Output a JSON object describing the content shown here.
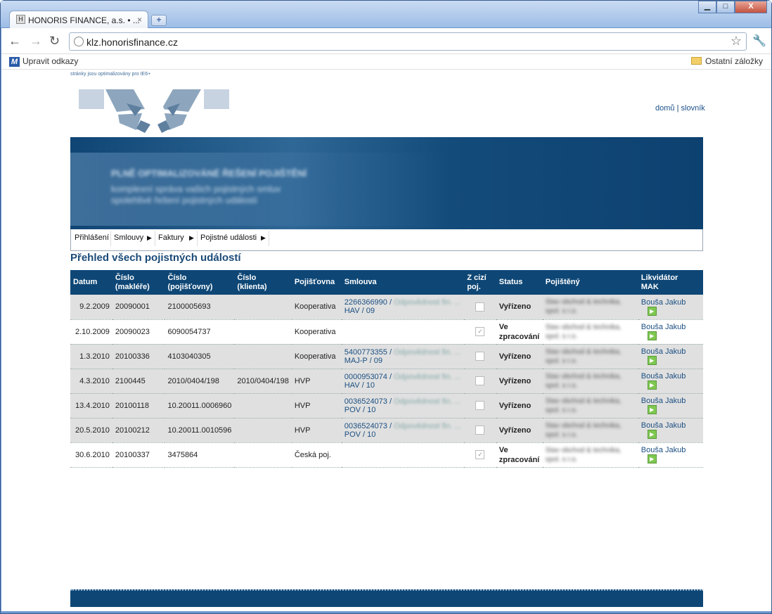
{
  "browser": {
    "tab_title": "HONORIS FINANCE, a.s. • ...",
    "tab_close": "×",
    "new_tab": "+",
    "url": "klz.honorisfinance.cz",
    "bookmark_left": "Upravit odkazy",
    "bookmark_right": "Ostatní záložky",
    "min": "▁",
    "max": "□",
    "close": "X"
  },
  "page": {
    "optimized_note": "stránky jsou optimalizovány pro IE6+",
    "top_links": {
      "home": "domů",
      "sep": " | ",
      "dictionary": "slovník"
    },
    "banner_lines": [
      "PLNĚ OPTIMALIZOVÁNÉ ŘEŠENÍ POJIŠTĚNÍ",
      "komplexní správa vašich pojistných smluv",
      "spolehlivé řešení pojistných událostí"
    ],
    "menu": {
      "login": "Přihlášení",
      "contracts": "Smlouvy",
      "invoices": "Faktury",
      "claims": "Pojistné události",
      "arrow": "▶"
    },
    "title": "Přehled všech pojistných událostí"
  },
  "table": {
    "headers": {
      "datum": "Datum",
      "cislo_makler_1": "Číslo",
      "cislo_makler_2": "(makléře)",
      "cislo_poj_1": "Číslo",
      "cislo_poj_2": "(pojišťovny)",
      "cislo_kl_1": "Číslo",
      "cislo_kl_2": "(klienta)",
      "pojistovna": "Pojišťovna",
      "smlouva": "Smlouva",
      "cizi_1": "Z cizí",
      "cizi_2": "poj.",
      "status": "Status",
      "pojisteny": "Pojištěný",
      "likv_1": "Likvidátor",
      "likv_2": "MAK"
    },
    "rows": [
      {
        "date": "9.2.2009",
        "makler": "20090001",
        "pojistovny": "2100005693",
        "klienta": "",
        "pojistovna": "Kooperativa",
        "smlouva_num": "2266366990",
        "smlouva_blur": "Odpovědnost fin. ...",
        "smlouva_suffix": "HAV / 09",
        "checked": "",
        "status": "Vyřízeno",
        "pojisteny_1": "Stav obchod & technika,",
        "pojisteny_2": "spol. s r.o.",
        "likvidator": "Bouša Jakub"
      },
      {
        "date": "2.10.2009",
        "makler": "20090023",
        "pojistovny": "6090054737",
        "klienta": "",
        "pojistovna": "Kooperativa",
        "smlouva_num": "",
        "smlouva_blur": "",
        "smlouva_suffix": "",
        "checked": "✓",
        "status": "Ve zpracování",
        "pojisteny_1": "Stav obchod & technika,",
        "pojisteny_2": "spol. s r.o.",
        "likvidator": "Bouša Jakub"
      },
      {
        "date": "1.3.2010",
        "makler": "20100336",
        "pojistovny": "4103040305",
        "klienta": "",
        "pojistovna": "Kooperativa",
        "smlouva_num": "5400773355",
        "smlouva_blur": "Odpovědnost fin. ...",
        "smlouva_suffix": "MAJ-P / 09",
        "checked": "",
        "status": "Vyřízeno",
        "pojisteny_1": "Stav obchod & technika,",
        "pojisteny_2": "spol. s r.o.",
        "likvidator": "Bouša Jakub"
      },
      {
        "date": "4.3.2010",
        "makler": "2100445",
        "pojistovny": "2010/0404/198",
        "klienta": "2010/0404/198",
        "pojistovna": "HVP",
        "smlouva_num": "0000953074",
        "smlouva_blur": "Odpovědnost fin. ...",
        "smlouva_suffix": "HAV / 10",
        "checked": "",
        "status": "Vyřízeno",
        "pojisteny_1": "Stav obchod & technika,",
        "pojisteny_2": "spol. s r.o.",
        "likvidator": "Bouša Jakub"
      },
      {
        "date": "13.4.2010",
        "makler": "20100118",
        "pojistovny": "10.20011.0006960",
        "klienta": "",
        "pojistovna": "HVP",
        "smlouva_num": "0036524073",
        "smlouva_blur": "Odpovědnost fin. ...",
        "smlouva_suffix": "POV / 10",
        "checked": "",
        "status": "Vyřízeno",
        "pojisteny_1": "Stav obchod & technika,",
        "pojisteny_2": "spol. s r.o.",
        "likvidator": "Bouša Jakub"
      },
      {
        "date": "20.5.2010",
        "makler": "20100212",
        "pojistovny": "10.20011.0010596",
        "klienta": "",
        "pojistovna": "HVP",
        "smlouva_num": "0036524073",
        "smlouva_blur": "Odpovědnost fin. ...",
        "smlouva_suffix": "POV / 10",
        "checked": "",
        "status": "Vyřízeno",
        "pojisteny_1": "Stav obchod & technika,",
        "pojisteny_2": "spol. s r.o.",
        "likvidator": "Bouša Jakub"
      },
      {
        "date": "30.6.2010",
        "makler": "20100337",
        "pojistovny": "3475864",
        "klienta": "",
        "pojistovna": "Česká poj.",
        "smlouva_num": "",
        "smlouva_blur": "",
        "smlouva_suffix": "",
        "checked": "✓",
        "status": "Ve zpracování",
        "pojisteny_1": "Stav obchod & technika,",
        "pojisteny_2": "spol. s r.o.",
        "likvidator": "Bouša Jakub"
      }
    ]
  },
  "colors": {
    "brand": "#0e4776",
    "link": "#1b4f82"
  },
  "icons": {
    "go": "play-arrow-icon",
    "checkbox": "checkbox-icon"
  }
}
